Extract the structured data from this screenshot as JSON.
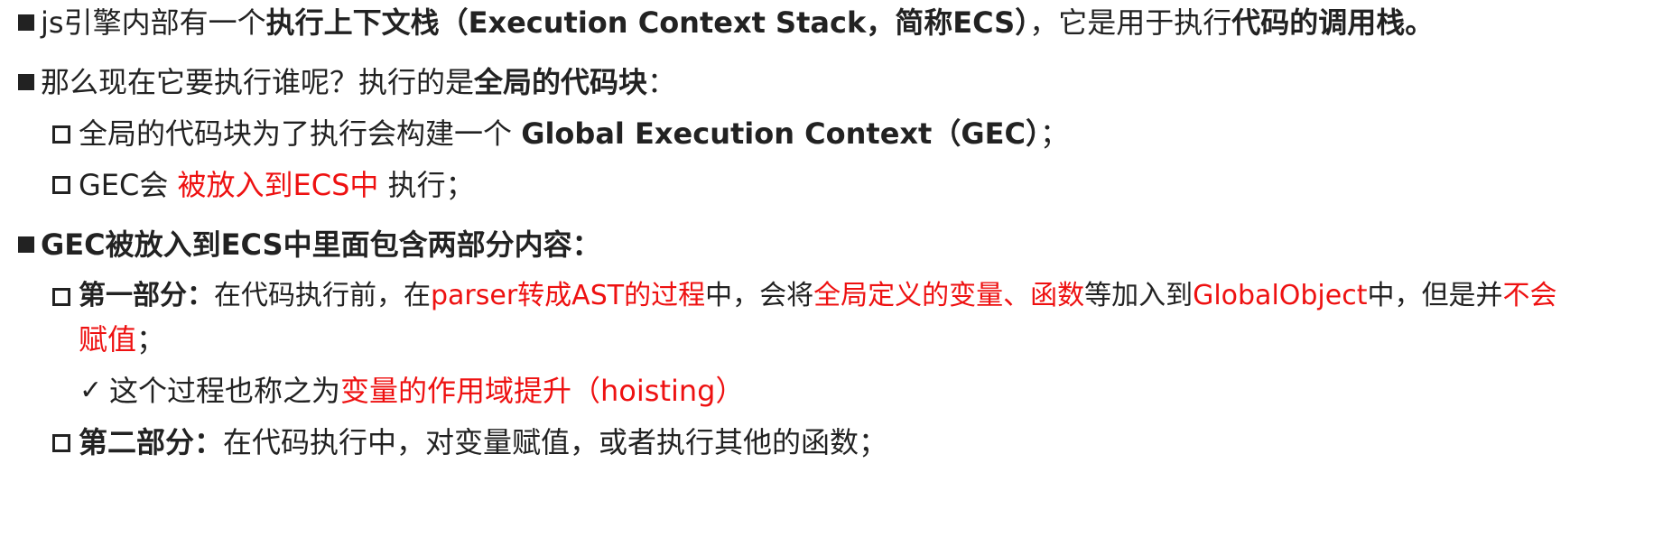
{
  "colors": {
    "text": "#222222",
    "highlight": "#ee1111",
    "background": "#ffffff"
  },
  "items": [
    {
      "id": "line1",
      "bullet": "square-filled",
      "segments": [
        {
          "text": "js引擎内部有一个",
          "bold": false,
          "red": false
        },
        {
          "text": "执行上下文栈（Execution Context Stack，简称ECS）",
          "bold": true,
          "red": false
        },
        {
          "text": "，它是用于执行",
          "bold": false,
          "red": false
        },
        {
          "text": "代码的调用栈。",
          "bold": true,
          "red": false
        }
      ]
    },
    {
      "id": "line2",
      "bullet": "square-filled",
      "segments": [
        {
          "text": "那么现在它要执行谁呢？执行的是",
          "bold": false,
          "red": false
        },
        {
          "text": "全局的代码块",
          "bold": true,
          "red": false
        },
        {
          "text": "：",
          "bold": false,
          "red": false
        }
      ]
    },
    {
      "id": "line3",
      "bullet": "square-hollow",
      "segments": [
        {
          "text": "全局的代码块为了执行会构建一个 ",
          "bold": false,
          "red": false
        },
        {
          "text": "Global Execution Context（GEC）",
          "bold": true,
          "red": false
        },
        {
          "text": "；",
          "bold": false,
          "red": false
        }
      ]
    },
    {
      "id": "line4",
      "bullet": "square-hollow",
      "segments": [
        {
          "text": "GEC会 ",
          "bold": false,
          "red": false
        },
        {
          "text": "被放入到ECS中",
          "bold": false,
          "red": true
        },
        {
          "text": " 执行；",
          "bold": false,
          "red": false
        }
      ]
    },
    {
      "id": "line5",
      "bullet": "square-filled",
      "segments": [
        {
          "text": "GEC被放入到ECS中里面包含两部分内容：",
          "bold": true,
          "red": false
        }
      ]
    },
    {
      "id": "line6",
      "bullet": "square-hollow",
      "segments": [
        {
          "text": "第一部分：",
          "bold": true,
          "red": false
        },
        {
          "text": "在代码执行前，在",
          "bold": false,
          "red": false
        },
        {
          "text": "parser转成AST的过程",
          "bold": false,
          "red": true
        },
        {
          "text": "中，会将",
          "bold": false,
          "red": false
        },
        {
          "text": "全局定义的变量、函数",
          "bold": false,
          "red": true
        },
        {
          "text": "等加入到",
          "bold": false,
          "red": false
        },
        {
          "text": "GlobalObject",
          "bold": false,
          "red": true
        },
        {
          "text": "中，但是并",
          "bold": false,
          "red": false
        },
        {
          "text": "不会",
          "bold": false,
          "red": true
        }
      ]
    },
    {
      "id": "line7",
      "bullet": "none",
      "segments": [
        {
          "text": "赋值",
          "bold": false,
          "red": true
        },
        {
          "text": "；",
          "bold": false,
          "red": false
        }
      ]
    },
    {
      "id": "line8",
      "bullet": "check",
      "bullet_glyph": "✓",
      "segments": [
        {
          "text": "这个过程也称之为",
          "bold": false,
          "red": false
        },
        {
          "text": "变量的作用域提升（hoisting）",
          "bold": false,
          "red": true
        }
      ]
    },
    {
      "id": "line9",
      "bullet": "square-hollow",
      "segments": [
        {
          "text": "第二部分：",
          "bold": true,
          "red": false
        },
        {
          "text": "在代码执行中，对变量赋值，或者执行其他的函数；",
          "bold": false,
          "red": false
        }
      ]
    }
  ]
}
